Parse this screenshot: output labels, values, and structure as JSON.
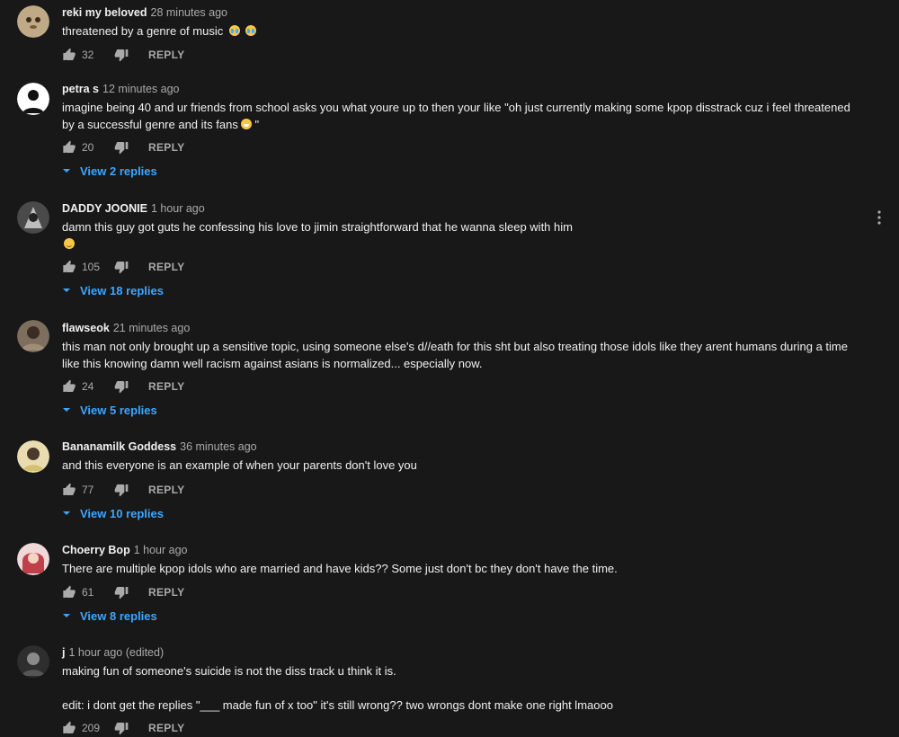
{
  "comments": [
    {
      "author": "reki my beloved",
      "time": "28 minutes ago",
      "text": "threatened by a genre of music",
      "emoji": [
        "cry",
        "cry"
      ],
      "likes": "32",
      "reply_label": "REPLY",
      "replies_label": null,
      "avatar_color": "#c9b49a"
    },
    {
      "author": "petra s",
      "time": "12 minutes ago",
      "text": "imagine being 40 and ur friends from school asks you what youre up to then your like \"oh just currently making some kpop disstrack cuz i feel threatened by a successful genre and its fans",
      "text_tail": " \"",
      "emoji": [
        "grin"
      ],
      "likes": "20",
      "reply_label": "REPLY",
      "replies_label": "View 2 replies",
      "avatar_color": "#ffffff"
    },
    {
      "author": "DADDY JOONIE",
      "time": "1 hour ago",
      "text": "damn this guy got guts he confessing his love to jimin straightforward that he wanna sleep with him",
      "emoji_newline": [
        "smile"
      ],
      "likes": "105",
      "reply_label": "REPLY",
      "replies_label": "View 18 replies",
      "avatar_color": "#5a5a5a"
    },
    {
      "author": "flawseok",
      "time": "21 minutes ago",
      "text": "this man not only brought up a sensitive topic, using someone else's d//eath for this sht but also treating those idols like they arent humans during a time like this knowing damn well racism against asians is normalized... especially now.",
      "likes": "24",
      "reply_label": "REPLY",
      "replies_label": "View 5 replies",
      "avatar_color": "#8a7a6a"
    },
    {
      "author": "Bananamilk Goddess",
      "time": "36 minutes ago",
      "text": "and this everyone is an example of when your parents don't love you",
      "likes": "77",
      "reply_label": "REPLY",
      "replies_label": "View 10 replies",
      "avatar_color": "#d8c89a"
    },
    {
      "author": "Choerry Bop",
      "time": "1 hour ago",
      "text": "There are multiple kpop idols who are married and have kids?? Some just don't bc they don't have the time.",
      "likes": "61",
      "reply_label": "REPLY",
      "replies_label": "View 8 replies",
      "avatar_color": "#c4505a"
    },
    {
      "author": "j",
      "time": "1 hour ago (edited)",
      "text": "making fun of someone's suicide is not the diss track u think it is.\n\nedit: i dont get the replies \"___ made fun of x too\" it's still wrong?? two wrongs dont make one right lmaooo",
      "likes": "209",
      "reply_label": "REPLY",
      "replies_label": null,
      "avatar_color": "#3a3a3a"
    }
  ],
  "icons": {
    "like": "thumbs-up-icon",
    "dislike": "thumbs-down-icon",
    "expand": "chevron-down-icon",
    "menu": "more-vert-icon"
  },
  "colors": {
    "background": "#181818",
    "text": "#f1f1f1",
    "secondary": "#aaaaaa",
    "link": "#3ea6ff"
  }
}
